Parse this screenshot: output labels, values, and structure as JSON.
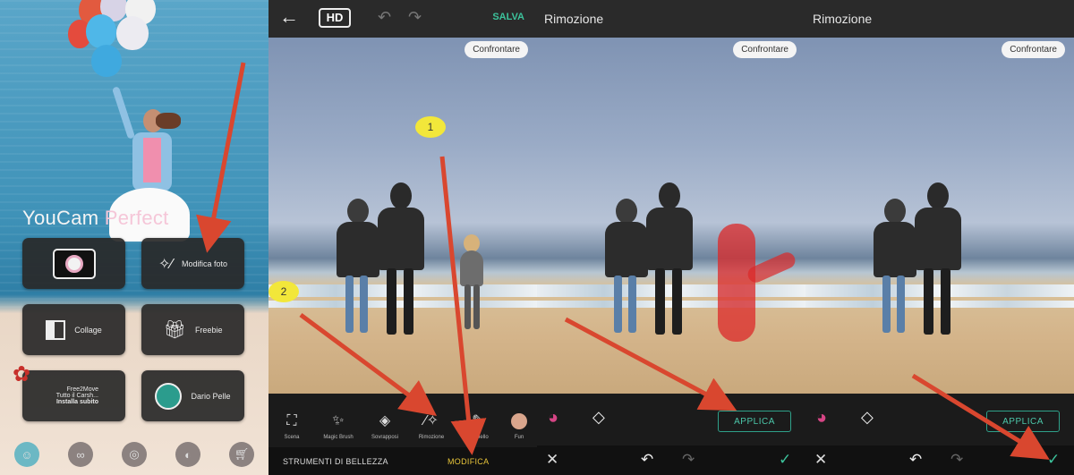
{
  "home": {
    "logo_prefix": "YouCam ",
    "logo_suffix": "Perfect",
    "tiles": {
      "edit_photo": "Modifica foto",
      "collage": "Collage",
      "freebie": "Freebie",
      "ad_line1": "Free2Move",
      "ad_line2": "Tutto il Carsh...",
      "ad_line3": "Installa subito",
      "profile_name": "Dario Pelle"
    }
  },
  "editor": {
    "hd_label": "HD",
    "save_label": "SALVA",
    "compare_label": "Confrontare",
    "marker_1": "1",
    "marker_2": "2",
    "tools": [
      "Scena",
      "Magic Brush",
      "Sovrapposi",
      "Rimozione",
      "Pennello",
      "Fun"
    ],
    "tab_beauty": "STRUMENTI DI BELLEZZA",
    "tab_edit": "MODIFICA"
  },
  "removal_a": {
    "title": "Rimozione",
    "compare_label": "Confrontare",
    "apply_label": "APPLICA"
  },
  "removal_b": {
    "title": "Rimozione",
    "compare_label": "Confrontare",
    "apply_label": "APPLICA"
  },
  "colors": {
    "accent_green": "#4cc7aa",
    "save_green": "#3cc39c",
    "edit_tab_yellow": "#e8c53a",
    "arrow_red": "#d9472f",
    "marker_yellow": "#f2e73a"
  }
}
